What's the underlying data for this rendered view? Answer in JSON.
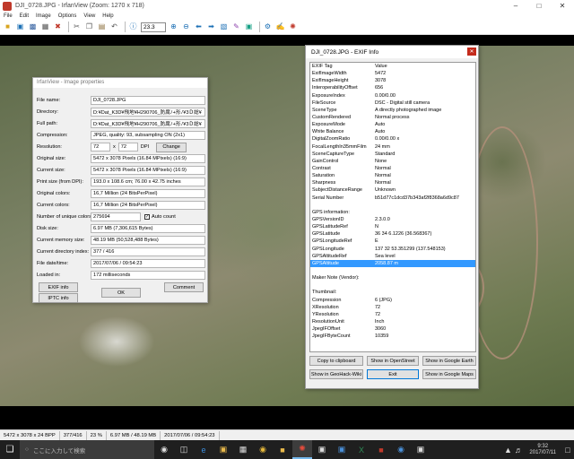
{
  "window": {
    "title": "DJI_0728.JPG - IrfanView (Zoom: 1270 x 718)"
  },
  "menu": [
    "File",
    "Edit",
    "Image",
    "Options",
    "View",
    "Help"
  ],
  "toolbar": {
    "zoom_value": "23.3"
  },
  "properties": {
    "title": "IrfanView - Image properties",
    "rows": [
      {
        "label": "File name:",
        "value": "DJI_0728.JPG"
      },
      {
        "label": "Directory:",
        "value": "D:¥Dat_K3D¥飛地¥H290706_防腐ﾉ+形ﾉ¥3Ｄ総¥"
      },
      {
        "label": "Full path:",
        "value": "D:¥Dat_K3D¥飛地¥H290706_防腐ﾉ+形ﾉ¥3Ｄ総¥"
      },
      {
        "label": "Compression:",
        "value": "JPEG, quality: 93, subsampling ON (2x1)"
      }
    ],
    "resolution_label": "Resolution:",
    "res_x": "72",
    "res_sep": "x",
    "res_y": "72",
    "res_unit": "DPI",
    "change_label": "Change",
    "rows2": [
      {
        "label": "Original size:",
        "value": "5472 x 3078  Pixels (16.84 MPixels) (16:9)"
      },
      {
        "label": "Current size:",
        "value": "5472 x 3078  Pixels (16.84 MPixels) (16:9)"
      },
      {
        "label": "Print size (from DPI):",
        "value": "193.0 x 108.6 cm; 76.00 x 42.75 inches"
      },
      {
        "label": "Original colors:",
        "value": "16,7 Million   (24 BitsPerPixel)"
      },
      {
        "label": "Current colors:",
        "value": "16,7 Million   (24 BitsPerPixel)"
      }
    ],
    "unique_label": "Number of unique colors:",
    "unique_value": "275694",
    "auto_count": "Auto count",
    "rows3": [
      {
        "label": "Disk size:",
        "value": "6.97 MB (7,306,615 Bytes)"
      },
      {
        "label": "Current memory size:",
        "value": "48.19  MB (50,528,488 Bytes)"
      },
      {
        "label": "Current directory index:",
        "value": "377  /  416"
      },
      {
        "label": "File date/time:",
        "value": "2017/07/06 / 09:54:23"
      },
      {
        "label": "Loaded in:",
        "value": "172 milliseconds"
      }
    ],
    "exif_btn": "EXIF info",
    "iptc_btn": "IPTC info",
    "ok_btn": "OK",
    "comment_btn": "Comment"
  },
  "exif": {
    "title": "DJI_0728.JPG - EXIF Info",
    "header": {
      "key": "EXIF Tag",
      "val": "Value"
    },
    "rows": [
      {
        "key": "ExifImageWidth",
        "val": "5472"
      },
      {
        "key": "ExifImageHeight",
        "val": "3078"
      },
      {
        "key": "InteroperabilityOffset",
        "val": "656"
      },
      {
        "key": "ExposureIndex",
        "val": "0.00/0.00"
      },
      {
        "key": "FileSource",
        "val": "DSC - Digital still camera"
      },
      {
        "key": "SceneType",
        "val": "A directly photographed image"
      },
      {
        "key": "CustomRendered",
        "val": "Normal process"
      },
      {
        "key": "ExposureMode",
        "val": "Auto"
      },
      {
        "key": "White Balance",
        "val": "Auto"
      },
      {
        "key": "DigitalZoomRatio",
        "val": "0.00/0.00 x"
      },
      {
        "key": "FocalLengthIn35mmFilm",
        "val": "24 mm"
      },
      {
        "key": "SceneCaptureType",
        "val": "Standard"
      },
      {
        "key": "GainControl",
        "val": "None"
      },
      {
        "key": "Contrast",
        "val": "Normal"
      },
      {
        "key": "Saturation",
        "val": "Normal"
      },
      {
        "key": "Sharpness",
        "val": "Normal"
      },
      {
        "key": "SubjectDistanceRange",
        "val": "Unknown"
      },
      {
        "key": "Serial Number",
        "val": "b51d77c1dcd37b343af2f8368a6d9c87"
      },
      {
        "key": "",
        "val": ""
      },
      {
        "key": "GPS information:",
        "val": ""
      },
      {
        "key": "GPSVersionID",
        "val": "2.3.0.0"
      },
      {
        "key": "GPSLatitudeRef",
        "val": "N"
      },
      {
        "key": "GPSLatitude",
        "val": "36  34  6.1226 (36.568367)"
      },
      {
        "key": "GPSLongitudeRef",
        "val": "E"
      },
      {
        "key": "GPSLongitude",
        "val": "137  32  53.351299 (137.548153)"
      },
      {
        "key": "GPSAltitudeRef",
        "val": "Sea level"
      },
      {
        "key": "GPSAltitude",
        "val": "2058.87 m",
        "selected": true
      },
      {
        "key": "",
        "val": ""
      },
      {
        "key": "Maker Note (Vendor):",
        "val": ""
      },
      {
        "key": "",
        "val": ""
      },
      {
        "key": "Thumbnail:",
        "val": ""
      },
      {
        "key": "Compression",
        "val": "6 (JPG)"
      },
      {
        "key": "XResolution",
        "val": "72"
      },
      {
        "key": "YResolution",
        "val": "72"
      },
      {
        "key": "ResolutionUnit",
        "val": "Inch"
      },
      {
        "key": "JpegIFOffset",
        "val": "3060"
      },
      {
        "key": "JpegIFByteCount",
        "val": "10359"
      }
    ],
    "buttons": {
      "copy": "Copy to clipboard",
      "openstreet": "Show in OpenStreet",
      "earth": "Show in Google Earth",
      "geohack": "Show in GeoHack-Wiki",
      "exit": "Exit",
      "maps": "Show in Google Maps"
    }
  },
  "status": [
    "5472 x 3078 x 24 BPP",
    "377/416",
    "23 %",
    "6.97 MB / 48.19 MB",
    "2017/07/06 / 09:54:23"
  ],
  "taskbar": {
    "search_placeholder": "ここに入力して検索",
    "time": "9:32",
    "date": "2017/07/11"
  }
}
